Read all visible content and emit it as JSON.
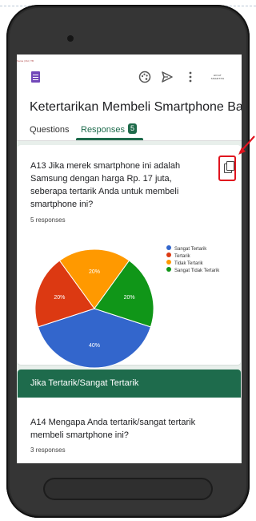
{
  "header": {
    "tiny_tag": "Nama | RH | TB",
    "brand": "HIKAT SMARTPH",
    "title": "Ketertarikan Membeli Smartphone Ba",
    "tabs": [
      {
        "label": "Questions"
      },
      {
        "label": "Responses",
        "badge": "5",
        "active": true
      }
    ]
  },
  "question1": {
    "text": "A13 Jika merek smartphone ini adalah Samsung dengan harga Rp. 17 juta, seberapa tertarik Anda untuk membeli smartphone ini?",
    "responses": "5 responses",
    "copy_icon": "copy-icon"
  },
  "chart_data": {
    "type": "pie",
    "series": [
      {
        "name": "Sangat Tertarik",
        "value": 40,
        "label": "40%",
        "color": "#3366cc"
      },
      {
        "name": "Tertarik",
        "value": 20,
        "label": "20%",
        "color": "#dc3912"
      },
      {
        "name": "Tidak Tertarik",
        "value": 20,
        "label": "20%",
        "color": "#ff9900"
      },
      {
        "name": "Sangat Tidak Tertarik",
        "value": 20,
        "label": "20%",
        "color": "#109618"
      }
    ],
    "legend_position": "right"
  },
  "section": {
    "title": "Jika Tertarik/Sangat Tertarik"
  },
  "question2": {
    "text": "A14 Mengapa Anda tertarik/sangat tertarik membeli smartphone ini?",
    "responses": "3 responses"
  },
  "colors": {
    "accent": "#1e6b4c",
    "annotation": "#e0141e"
  }
}
